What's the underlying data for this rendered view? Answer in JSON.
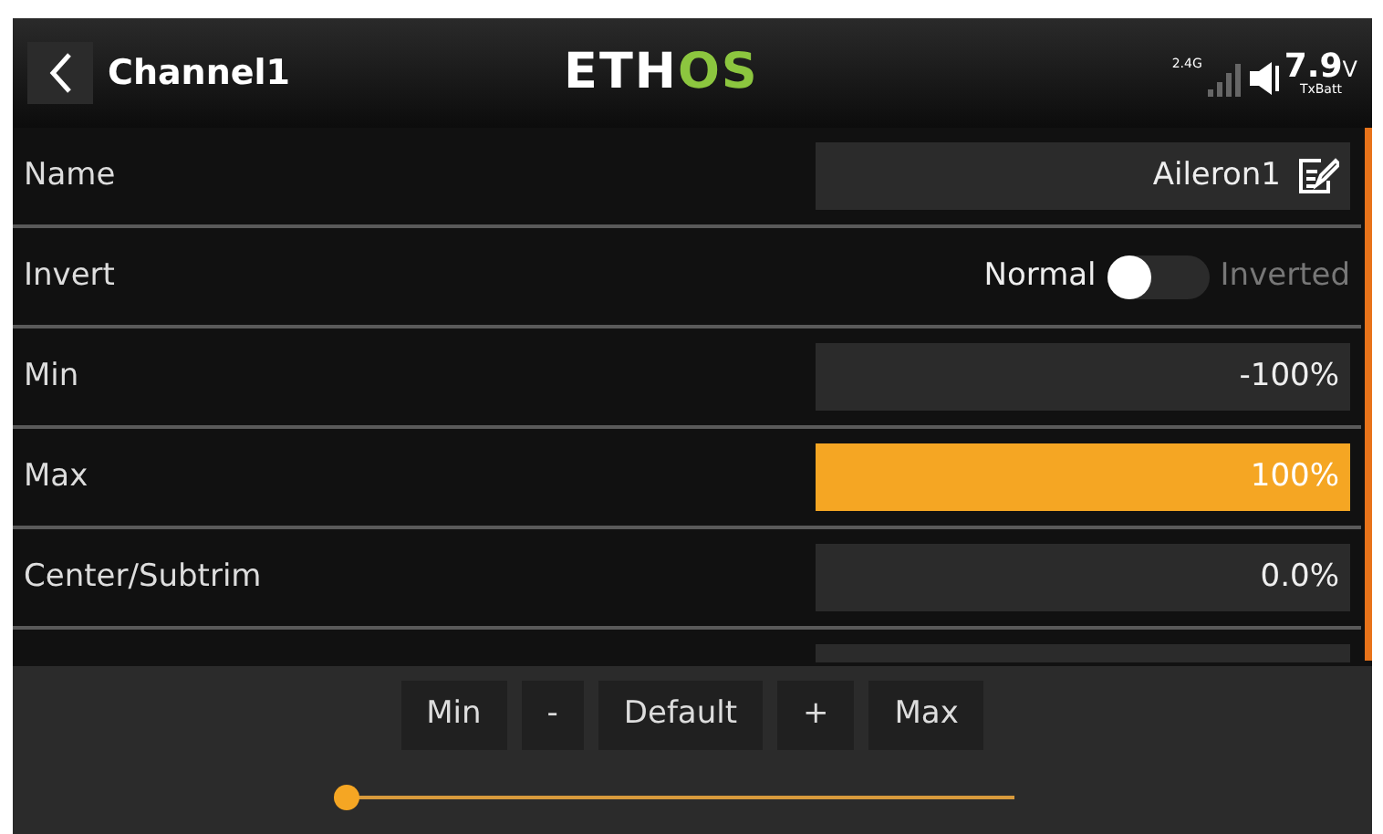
{
  "header": {
    "title": "Channel1",
    "logo": [
      {
        "text": "ETH",
        "color": "#ffffff"
      },
      {
        "text": "OS",
        "color": "#8cc63f"
      }
    ],
    "radio_band": "2.4G",
    "voltage": "7.9",
    "voltage_unit": "V",
    "voltage_label": "TxBatt"
  },
  "rows": [
    {
      "label": "Name",
      "kind": "text",
      "value": "Aileron1",
      "selected": false
    },
    {
      "label": "Invert",
      "kind": "toggle",
      "off_label": "Normal",
      "on_label": "Inverted",
      "on": false
    },
    {
      "label": "Min",
      "kind": "number",
      "value": "-100%",
      "selected": false
    },
    {
      "label": "Max",
      "kind": "number",
      "value": "100%",
      "selected": true
    },
    {
      "label": "Center/Subtrim",
      "kind": "number",
      "value": "0.0%",
      "selected": false
    }
  ],
  "buttons": [
    "Min",
    "-",
    "Default",
    "+",
    "Max"
  ],
  "slider": {
    "level": 0
  }
}
